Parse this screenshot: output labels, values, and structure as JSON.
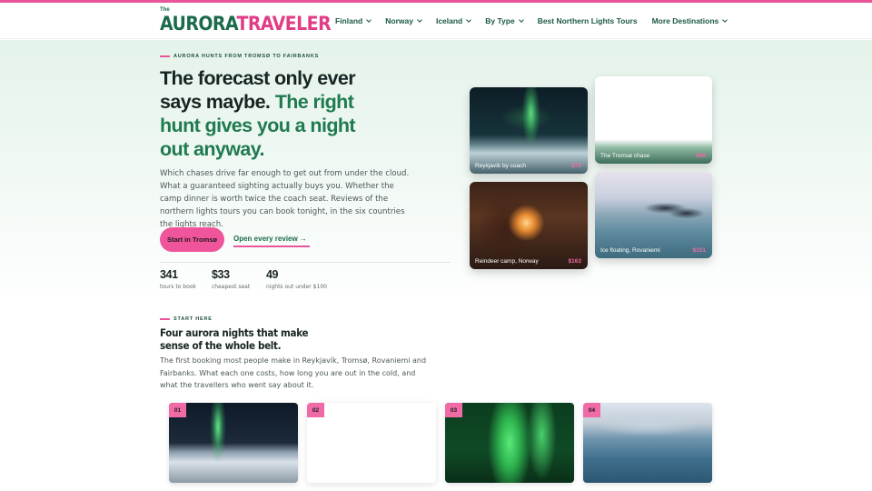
{
  "brand": {
    "the": "The",
    "aurora": "AURORA",
    "traveler": "TRAVELER"
  },
  "nav": [
    {
      "label": "Finland",
      "dropdown": true
    },
    {
      "label": "Norway",
      "dropdown": true
    },
    {
      "label": "Iceland",
      "dropdown": true
    },
    {
      "label": "By Type",
      "dropdown": true
    },
    {
      "label": "Best Northern Lights Tours",
      "dropdown": false
    },
    {
      "label": "More Destinations",
      "dropdown": true
    }
  ],
  "hero": {
    "eyebrow": "AURORA HUNTS FROM TROMSØ TO FAIRBANKS",
    "headline_dark": "The forecast only ever says maybe.",
    "headline_green": "The right hunt gives you a night out anyway.",
    "lead": "Which chases drive far enough to get out from under the cloud. What a guaranteed sighting actually buys you. Whether the camp dinner is worth twice the coach seat. Reviews of the northern lights tours you can book tonight, in the six countries the lights reach.",
    "cta_primary": "Start in Tromsø",
    "cta_link": "Open every review →",
    "stats": [
      {
        "value": "341",
        "label": "tours to book"
      },
      {
        "value": "$33",
        "label": "cheapest seat"
      },
      {
        "value": "49",
        "label": "nights out under $100"
      }
    ]
  },
  "feature_cards": [
    {
      "caption": "Reykjavík by coach",
      "price": "$74"
    },
    {
      "caption": "The Tromsø chase",
      "price": "$98"
    },
    {
      "caption": "Reindeer camp, Norway",
      "price": "$163"
    },
    {
      "caption": "Ice floating, Rovaniemi",
      "price": "$151"
    }
  ],
  "start": {
    "eyebrow": "START HERE",
    "title": "Four aurora nights that make sense of the whole belt.",
    "lead": "The first booking most people make in Reykjavík, Tromsø, Rovaniemi and Fairbanks. What each one costs, how long you are out in the cold, and what the travellers who went say about it.",
    "tiles": [
      "01",
      "02",
      "03",
      "04"
    ]
  },
  "colors": {
    "accent_pink": "#f0559b",
    "brand_green": "#1b6a4a",
    "hero_bg": "#e4f3ea"
  }
}
